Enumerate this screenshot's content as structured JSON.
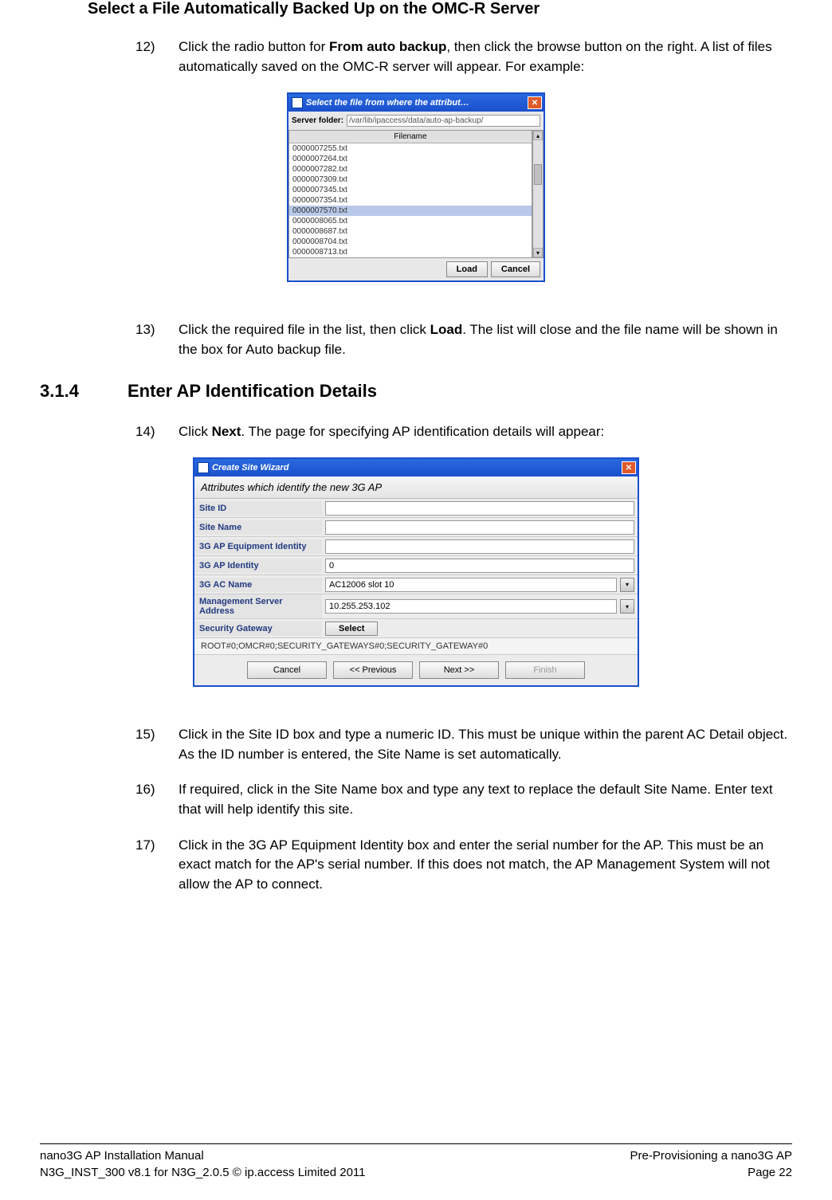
{
  "heading1": "Select a File Automatically Backed Up on the OMC-R Server",
  "steps": {
    "s12": {
      "num": "12)",
      "pre": "Click the radio button for ",
      "bold": "From auto backup",
      "post": ", then click the browse button on the right. A list of files automatically saved on the OMC-R server will appear. For example:"
    },
    "s13": {
      "num": "13)",
      "pre": "Click the required file in the list, then click ",
      "bold": "Load",
      "post": ". The list will close and the file name will be shown in the box for Auto backup file."
    },
    "s14": {
      "num": "14)",
      "pre": "Click ",
      "bold": "Next",
      "post": ". The page for specifying AP identification details will appear:"
    },
    "s15": {
      "num": "15)",
      "text": "Click in the Site ID box and type a numeric ID. This must be unique within the parent AC Detail object. As the ID number is entered, the Site Name is set automatically."
    },
    "s16": {
      "num": "16)",
      "text": "If required, click in the Site Name box and type any text to replace the default Site Name. Enter text that will help identify this site."
    },
    "s17": {
      "num": "17)",
      "text": "Click in the 3G AP Equipment Identity box and enter the serial number for the AP. This must be an exact match for the AP's serial number. If this does not match, the AP Management System will not allow the AP to connect."
    }
  },
  "subsection": {
    "num": "3.1.4",
    "title": "Enter AP Identification Details"
  },
  "dialog1": {
    "title": "Select the file from where the attribut…",
    "folder_label": "Server folder:",
    "folder_value": "/var/lib/ipaccess/data/auto-ap-backup/",
    "filename_header": "Filename",
    "files": [
      "0000007255.txt",
      "0000007264.txt",
      "0000007282.txt",
      "0000007309.txt",
      "0000007345.txt",
      "0000007354.txt",
      "0000007570.txt",
      "0000008065.txt",
      "0000008687.txt",
      "0000008704.txt",
      "0000008713.txt"
    ],
    "selected_index": 6,
    "load_label": "Load",
    "cancel_label": "Cancel"
  },
  "dialog2": {
    "title": "Create Site Wizard",
    "subtitle": "Attributes which identify the new 3G AP",
    "rows": {
      "site_id": {
        "label": "Site ID",
        "value": ""
      },
      "site_name": {
        "label": "Site Name",
        "value": ""
      },
      "equip_id": {
        "label": "3G AP Equipment Identity",
        "value": ""
      },
      "ap_identity": {
        "label": "3G AP Identity",
        "value": "0"
      },
      "ac_name": {
        "label": "3G AC Name",
        "value": "AC12006 slot 10"
      },
      "mgmt_addr": {
        "label": "Management Server Address",
        "value": "10.255.253.102"
      },
      "sec_gw": {
        "label": "Security Gateway",
        "select_label": "Select"
      }
    },
    "gateway_path": "ROOT#0;OMCR#0;SECURITY_GATEWAYS#0;SECURITY_GATEWAY#0",
    "buttons": {
      "cancel": "Cancel",
      "prev": "<< Previous",
      "next": "Next >>",
      "finish": "Finish"
    }
  },
  "footer": {
    "left1": "nano3G AP Installation Manual",
    "left2": "N3G_INST_300 v8.1 for N3G_2.0.5 © ip.access Limited 2011",
    "right1": "Pre-Provisioning a nano3G AP",
    "right2": "Page 22"
  }
}
